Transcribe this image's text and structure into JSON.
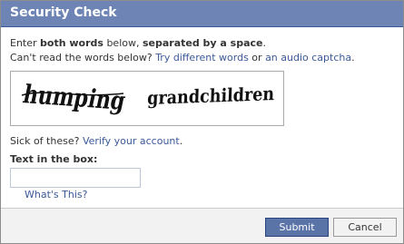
{
  "dialog": {
    "title": "Security Check"
  },
  "instructions": {
    "line1_prefix": "Enter ",
    "line1_bold1": "both words",
    "line1_middle": " below, ",
    "line1_bold2": "separated by a space",
    "line1_suffix": ".",
    "line2_prefix": "Can't read the words below? ",
    "try_different_link": "Try different words",
    "line2_or": " or ",
    "audio_link": "an audio captcha",
    "line2_suffix": "."
  },
  "captcha": {
    "word1": "humping",
    "word2": "grandchildren"
  },
  "verify": {
    "prefix": "Sick of these? ",
    "link": "Verify your account",
    "suffix": "."
  },
  "textbox": {
    "label": "Text in the box:",
    "value": "",
    "placeholder": ""
  },
  "help_link": "What's This?",
  "footer": {
    "submit_label": "Submit",
    "cancel_label": "Cancel"
  },
  "colors": {
    "title_bar": "#6d84b4",
    "link": "#3b5998",
    "submit_bg": "#5b74a8"
  }
}
